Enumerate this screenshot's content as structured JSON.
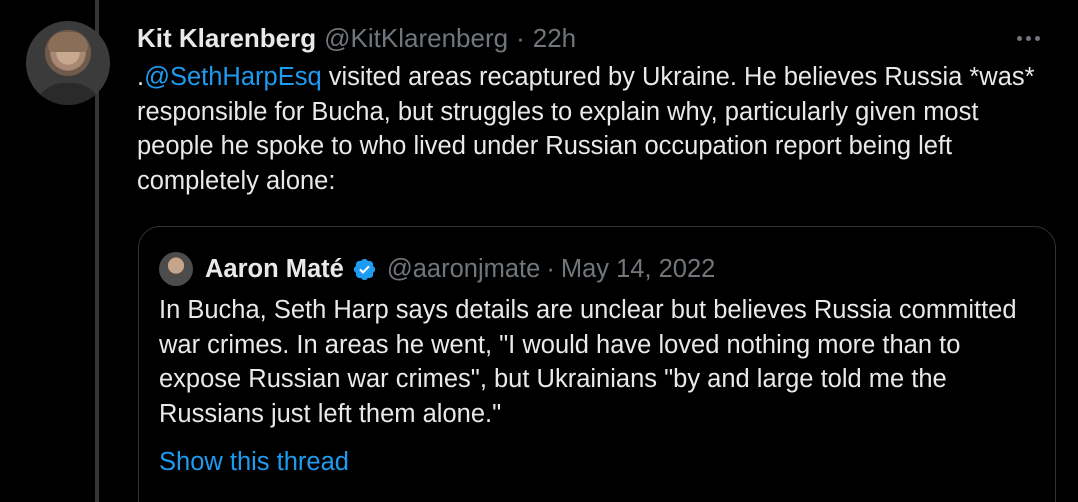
{
  "tweet": {
    "author_name": "Kit Klarenberg",
    "author_handle": "@KitKlarenberg",
    "separator": "·",
    "time": "22h",
    "body_prefix": ".",
    "body_mention": "@SethHarpEsq",
    "body_rest": " visited areas recaptured by Ukraine. He believes Russia *was* responsible for Bucha, but struggles to explain why, particularly given most people he spoke to who lived under Russian occupation report being left completely alone:",
    "more_icon": "more-icon"
  },
  "quote": {
    "author_name": "Aaron Maté",
    "verified_icon": "verified-badge-icon",
    "author_handle": "@aaronjmate",
    "separator": "·",
    "date": "May 14, 2022",
    "text": "In Bucha, Seth Harp says details are unclear but believes Russia committed war crimes. In areas he went, \"I would have loved nothing more than to expose Russian war crimes\", but Ukrainians \"by and large told me the Russians just left them alone.\"",
    "show_thread_label": "Show this thread"
  },
  "colors": {
    "background": "#000000",
    "text": "#e7e9ea",
    "secondary": "#71767b",
    "accent": "#1d9bf0",
    "border": "#2f3336"
  }
}
